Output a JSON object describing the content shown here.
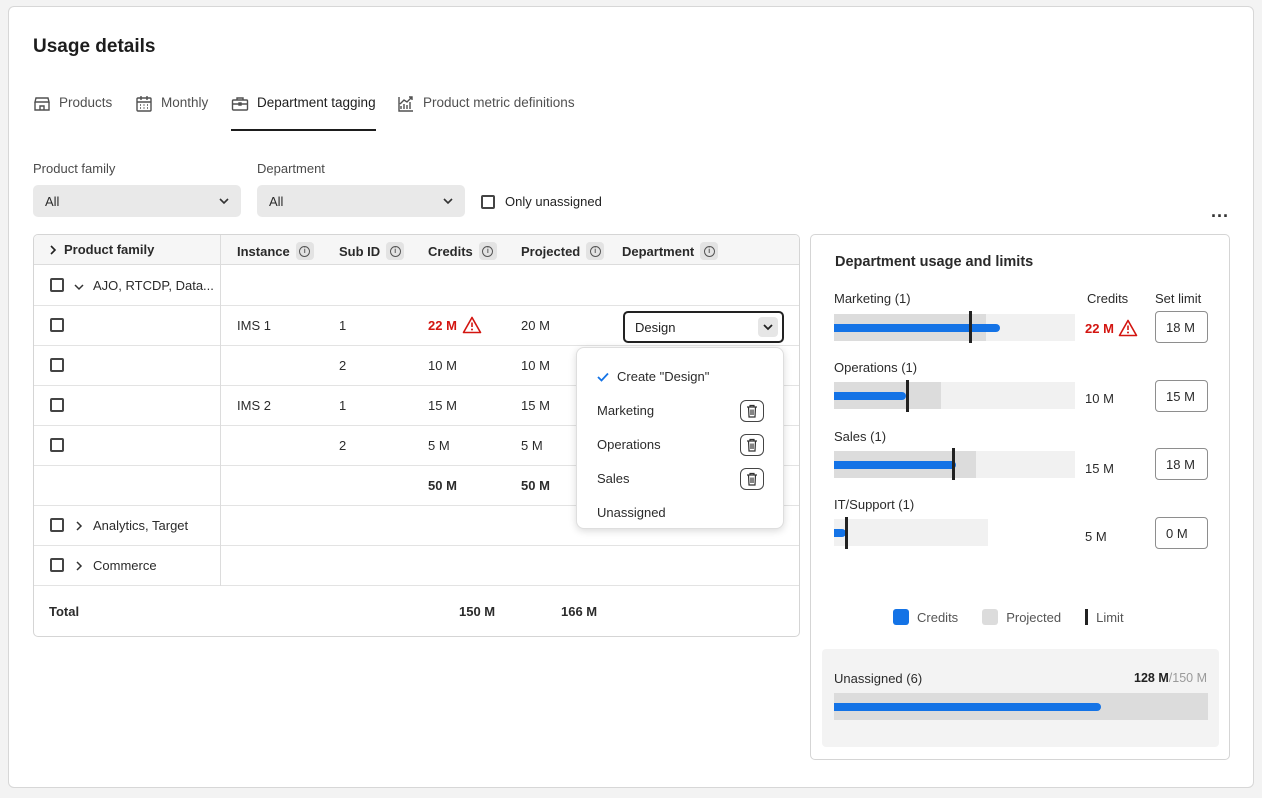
{
  "page_title": "Usage details",
  "tabs": [
    {
      "label": "Products",
      "icon": "store-icon"
    },
    {
      "label": "Monthly",
      "icon": "calendar-icon"
    },
    {
      "label": "Department tagging",
      "icon": "briefcase-icon",
      "active": true
    },
    {
      "label": "Product metric definitions",
      "icon": "chart-growth-icon"
    }
  ],
  "filters": {
    "product_family_label": "Product family",
    "product_family_value": "All",
    "department_label": "Department",
    "department_value": "All",
    "only_unassigned_label": "Only unassigned",
    "only_unassigned_checked": false
  },
  "more_actions": "...",
  "table": {
    "headers": {
      "product_family": "Product family",
      "instance": "Instance",
      "sub_id": "Sub ID",
      "credits": "Credits",
      "projected": "Projected",
      "department": "Department"
    },
    "groups": [
      {
        "name": "AJO, RTCDP, Data...",
        "expanded": true
      },
      {
        "name": "Analytics, Target",
        "expanded": false
      },
      {
        "name": "Commerce",
        "expanded": false
      }
    ],
    "rows": [
      {
        "instance": "IMS 1",
        "sub_id": "1",
        "credits": "22 M",
        "projected": "20 M",
        "department": "Design",
        "warning": true
      },
      {
        "instance": "",
        "sub_id": "2",
        "credits": "10 M",
        "projected": "10 M"
      },
      {
        "instance": "IMS 2",
        "sub_id": "1",
        "credits": "15 M",
        "projected": "15 M"
      },
      {
        "instance": "",
        "sub_id": "2",
        "credits": "5 M",
        "projected": "5 M"
      }
    ],
    "subtotal": {
      "credits": "50 M",
      "projected": "50 M"
    },
    "total": {
      "label": "Total",
      "credits": "150 M",
      "projected": "166 M"
    }
  },
  "department_menu": {
    "items": [
      {
        "label": "Create \"Design\"",
        "checked": true,
        "deletable": false
      },
      {
        "label": "Marketing",
        "deletable": true
      },
      {
        "label": "Operations",
        "deletable": true
      },
      {
        "label": "Sales",
        "deletable": true
      },
      {
        "label": "Unassigned",
        "deletable": false
      }
    ]
  },
  "panel": {
    "title": "Department usage and limits",
    "col_credits": "Credits",
    "col_set_limit": "Set limit",
    "departments": [
      {
        "name": "Marketing (1)",
        "credits": "22 M",
        "over_limit": true,
        "limit": "18 M",
        "credits_value": 22,
        "projected_value": 20,
        "limit_value": 18
      },
      {
        "name": "Operations (1)",
        "credits": "10 M",
        "limit": "15 M",
        "credits_value": 10,
        "projected_value": 10,
        "limit_value": 15
      },
      {
        "name": "Sales (1)",
        "credits": "15 M",
        "limit": "18 M",
        "credits_value": 15,
        "projected_value": 15,
        "limit_value": 18
      },
      {
        "name": "IT/Support (1)",
        "credits": "5 M",
        "limit": "0 M",
        "credits_value": 5,
        "projected_value": 5,
        "limit_value": 0
      }
    ],
    "legend": {
      "credits": "Credits",
      "projected": "Projected",
      "limit": "Limit"
    },
    "unassigned": {
      "label": "Unassigned (6)",
      "used": "128 M",
      "total": "/150 M",
      "fill_fraction": 0.853
    },
    "colors": {
      "credits": "#1473e6",
      "projected": "#dcdcdc",
      "warning": "#d31510"
    }
  }
}
